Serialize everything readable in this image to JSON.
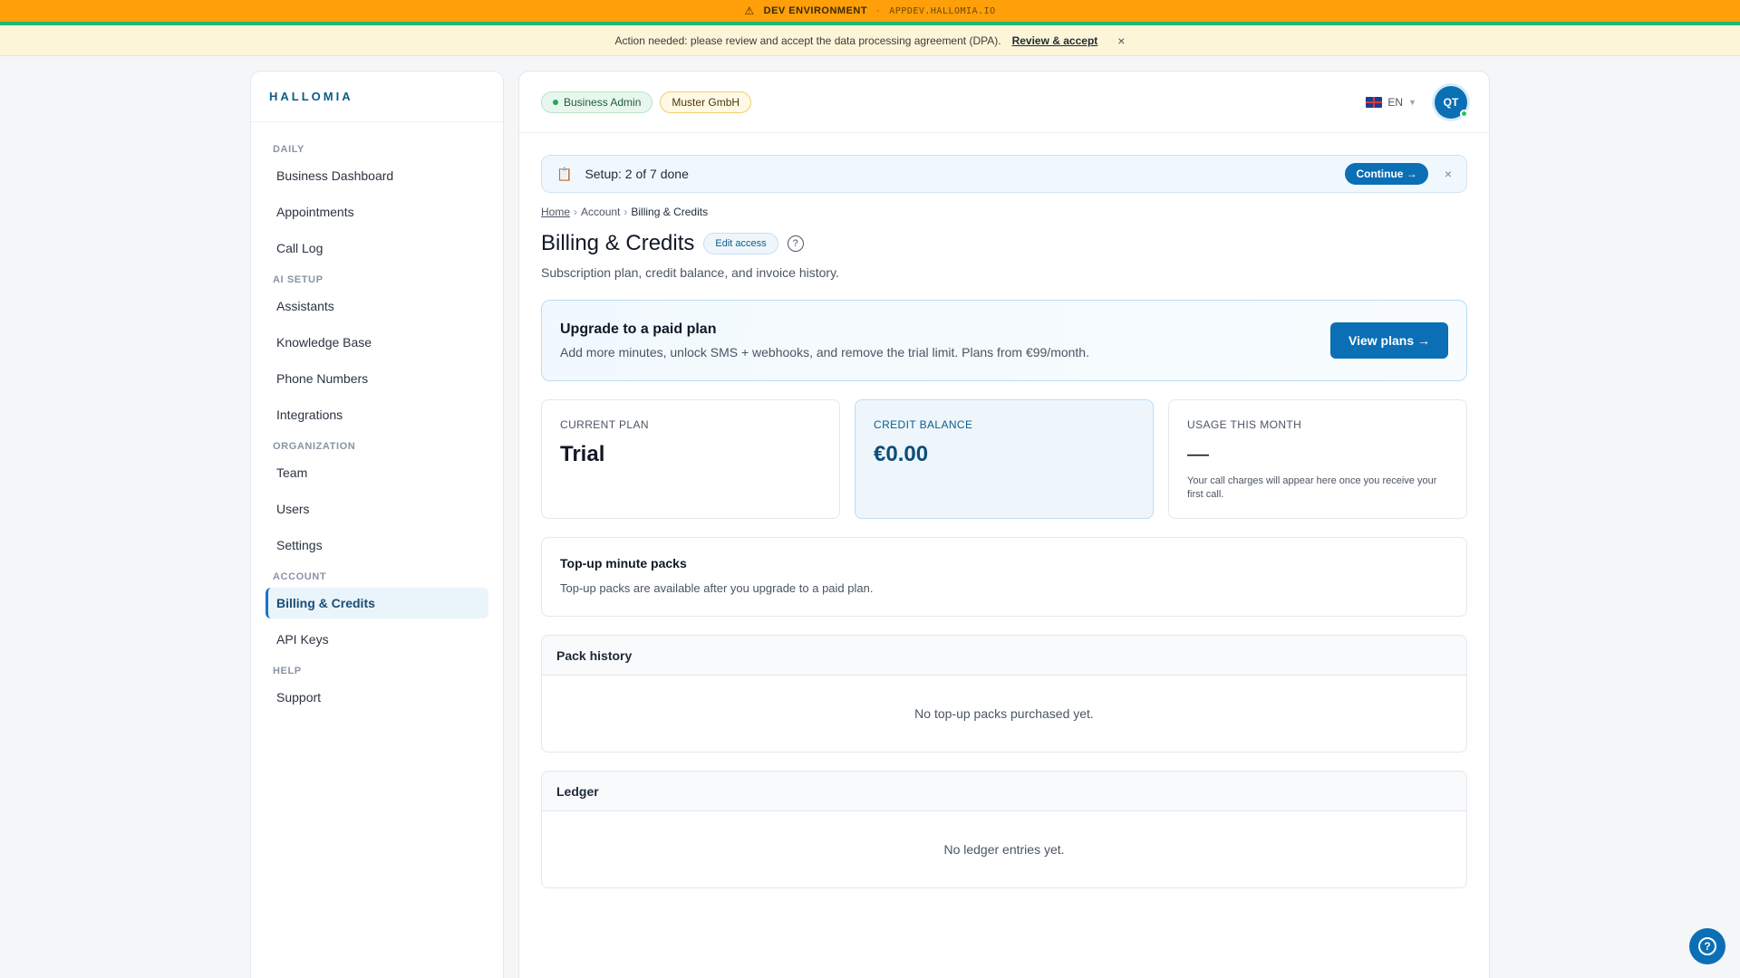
{
  "devbar": {
    "warning_icon": "warning-icon",
    "label": "DEV ENVIRONMENT",
    "separator": "·",
    "url": "APPDEV.HALLOMIA.IO"
  },
  "notice": {
    "text": "Action needed: please review and accept the data processing agreement (DPA).",
    "link": "Review & accept",
    "close": "×"
  },
  "sidebar": {
    "brand": "HALLOMIA",
    "sections": {
      "daily": "DAILY",
      "ai_setup": "AI SETUP",
      "organization": "ORGANIZATION",
      "account": "ACCOUNT",
      "help": "HELP"
    },
    "items": {
      "business_dashboard": "Business Dashboard",
      "appointments": "Appointments",
      "call_log": "Call Log",
      "assistants": "Assistants",
      "knowledge_base": "Knowledge Base",
      "phone_numbers": "Phone Numbers",
      "integrations": "Integrations",
      "team": "Team",
      "users": "Users",
      "settings": "Settings",
      "billing_credits": "Billing & Credits",
      "api_keys": "API Keys",
      "support": "Support"
    },
    "active": "billing_credits"
  },
  "topbar": {
    "role_badge": "Business Admin",
    "org_badge": "Muster GmbH",
    "language": "EN",
    "avatar_initials": "QT"
  },
  "setup": {
    "text": "Setup: 2 of 7 done",
    "continue": "Continue →",
    "close": "×"
  },
  "breadcrumb": {
    "home": "Home",
    "account": "Account",
    "current": "Billing & Credits",
    "sep": "›"
  },
  "page": {
    "title": "Billing & Credits",
    "edit_access": "Edit access",
    "help": "?",
    "subtitle": "Subscription plan, credit balance, and invoice history."
  },
  "upgrade": {
    "title": "Upgrade to a paid plan",
    "desc": "Add more minutes, unlock SMS + webhooks, and remove the trial limit. Plans from €99/month.",
    "button": "View plans →"
  },
  "cards": {
    "current_plan": {
      "label": "CURRENT PLAN",
      "value": "Trial"
    },
    "credit_balance": {
      "label": "CREDIT BALANCE",
      "value": "€0.00"
    },
    "usage": {
      "label": "USAGE THIS MONTH",
      "value": "—",
      "note": "Your call charges will appear here once you receive your first call."
    }
  },
  "topup": {
    "title": "Top-up minute packs",
    "desc": "Top-up packs are available after you upgrade to a paid plan."
  },
  "pack_history": {
    "title": "Pack history",
    "empty": "No top-up packs purchased yet."
  },
  "ledger": {
    "title": "Ledger",
    "empty": "No ledger entries yet."
  },
  "floating_help": "?",
  "colors": {
    "devbar": "#ff9f0a",
    "accent": "#0b6fb5",
    "notice_bg": "#fdf5d8"
  }
}
